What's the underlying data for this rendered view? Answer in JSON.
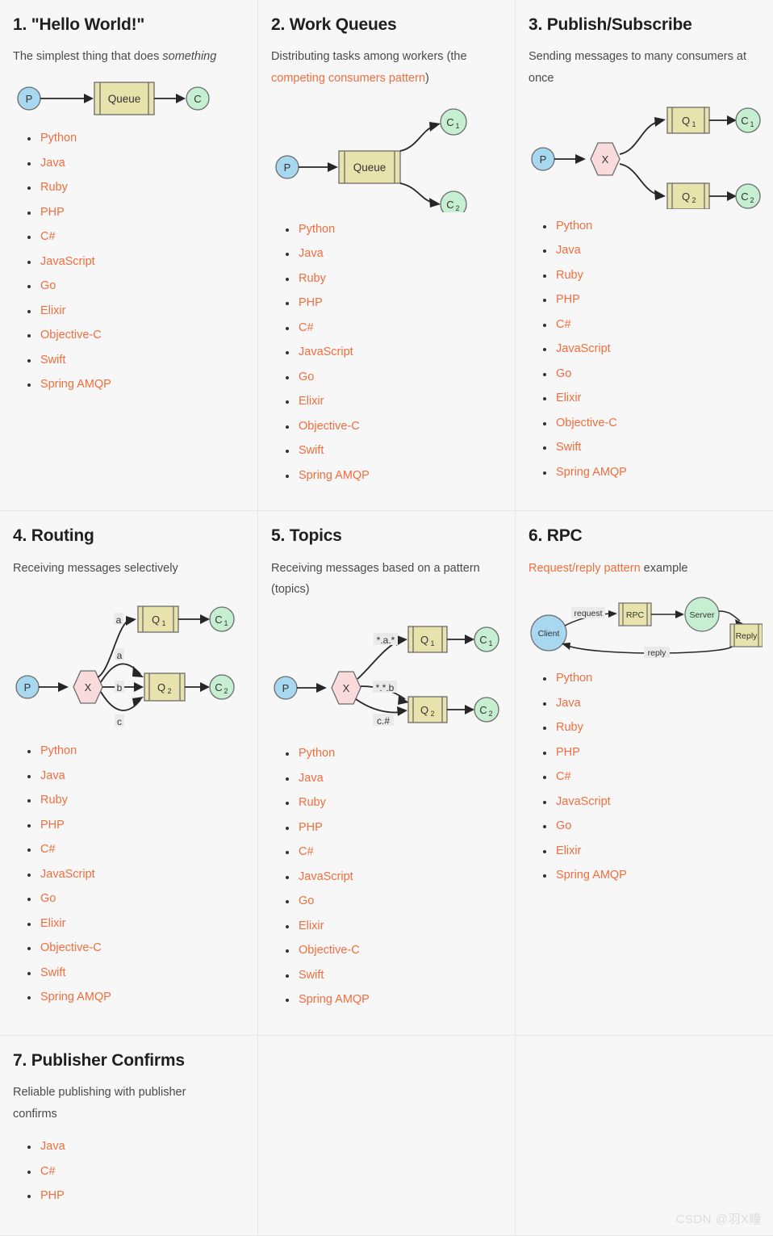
{
  "colors": {
    "link": "#f26d3d",
    "card_bg": "#f7f7f7",
    "queue_fill": "#e8e3ac",
    "producer_fill": "#a8d8f0",
    "consumer_fill": "#c6eed0",
    "exchange_fill": "#fadbdc",
    "stroke": "#6b6b6b",
    "arrow": "#262626",
    "watermark": "#dcdcdc"
  },
  "watermark": "CSDN @羽X瞳",
  "languages_full": [
    "Python",
    "Java",
    "Ruby",
    "PHP",
    "C#",
    "JavaScript",
    "Go",
    "Elixir",
    "Objective-C",
    "Swift",
    "Spring AMQP"
  ],
  "cards": [
    {
      "id": "hello-world",
      "title": "1. \"Hello World!\"",
      "desc_prefix": "The simplest thing that does ",
      "desc_em": "something",
      "desc_suffix": "",
      "diagram": {
        "type": "producer-queue-consumer",
        "nodes": [
          {
            "name": "producer",
            "label": "P"
          },
          {
            "name": "queue",
            "label": "Queue"
          },
          {
            "name": "consumer",
            "label": "C"
          }
        ]
      },
      "languages": [
        "Python",
        "Java",
        "Ruby",
        "PHP",
        "C#",
        "JavaScript",
        "Go",
        "Elixir",
        "Objective-C",
        "Swift",
        "Spring AMQP"
      ]
    },
    {
      "id": "work-queues",
      "title": "2. Work Queues",
      "desc_prefix": "Distributing tasks among workers (the ",
      "desc_link": "competing consumers pattern",
      "desc_suffix": ")",
      "diagram": {
        "type": "producer-queue-two-consumers",
        "nodes": [
          {
            "name": "producer",
            "label": "P"
          },
          {
            "name": "queue",
            "label": "Queue"
          },
          {
            "name": "consumer-1",
            "label": "C",
            "sub": "1"
          },
          {
            "name": "consumer-2",
            "label": "C",
            "sub": "2"
          }
        ]
      },
      "languages": [
        "Python",
        "Java",
        "Ruby",
        "PHP",
        "C#",
        "JavaScript",
        "Go",
        "Elixir",
        "Objective-C",
        "Swift",
        "Spring AMQP"
      ]
    },
    {
      "id": "publish-subscribe",
      "title": "3. Publish/Subscribe",
      "desc_prefix": "Sending messages to many consumers at once",
      "diagram": {
        "type": "fanout",
        "nodes": [
          {
            "name": "producer",
            "label": "P"
          },
          {
            "name": "exchange",
            "label": "X"
          },
          {
            "name": "queue-1",
            "label": "Q",
            "sub": "1"
          },
          {
            "name": "queue-2",
            "label": "Q",
            "sub": "2"
          },
          {
            "name": "consumer-1",
            "label": "C",
            "sub": "1"
          },
          {
            "name": "consumer-2",
            "label": "C",
            "sub": "2"
          }
        ]
      },
      "languages": [
        "Python",
        "Java",
        "Ruby",
        "PHP",
        "C#",
        "JavaScript",
        "Go",
        "Elixir",
        "Objective-C",
        "Swift",
        "Spring AMQP"
      ]
    },
    {
      "id": "routing",
      "title": "4. Routing",
      "desc_prefix": "Receiving messages selectively",
      "diagram": {
        "type": "direct-routing",
        "nodes": [
          {
            "name": "producer",
            "label": "P"
          },
          {
            "name": "exchange",
            "label": "X"
          },
          {
            "name": "queue-1",
            "label": "Q",
            "sub": "1"
          },
          {
            "name": "queue-2",
            "label": "Q",
            "sub": "2"
          },
          {
            "name": "consumer-1",
            "label": "C",
            "sub": "1"
          },
          {
            "name": "consumer-2",
            "label": "C",
            "sub": "2"
          }
        ],
        "binding_keys": [
          "a",
          "a",
          "b",
          "c"
        ]
      },
      "languages": [
        "Python",
        "Java",
        "Ruby",
        "PHP",
        "C#",
        "JavaScript",
        "Go",
        "Elixir",
        "Objective-C",
        "Swift",
        "Spring AMQP"
      ]
    },
    {
      "id": "topics",
      "title": "5. Topics",
      "desc_prefix": "Receiving messages based on a pattern (topics)",
      "diagram": {
        "type": "topic-routing",
        "nodes": [
          {
            "name": "producer",
            "label": "P"
          },
          {
            "name": "exchange",
            "label": "X"
          },
          {
            "name": "queue-1",
            "label": "Q",
            "sub": "1"
          },
          {
            "name": "queue-2",
            "label": "Q",
            "sub": "2"
          },
          {
            "name": "consumer-1",
            "label": "C",
            "sub": "1"
          },
          {
            "name": "consumer-2",
            "label": "C",
            "sub": "2"
          }
        ],
        "binding_keys": [
          "*.a.*",
          "*.*.b",
          "c.#"
        ]
      },
      "languages": [
        "Python",
        "Java",
        "Ruby",
        "PHP",
        "C#",
        "JavaScript",
        "Go",
        "Elixir",
        "Objective-C",
        "Swift",
        "Spring AMQP"
      ]
    },
    {
      "id": "rpc",
      "title": "6. RPC",
      "desc_link": "Request/reply pattern",
      "desc_suffix": " example",
      "diagram": {
        "type": "rpc",
        "nodes": [
          {
            "name": "client",
            "label": "Client"
          },
          {
            "name": "rpc-queue",
            "label": "RPC"
          },
          {
            "name": "server",
            "label": "Server"
          },
          {
            "name": "reply-queue",
            "label": "Reply"
          }
        ],
        "edge_labels": [
          "request",
          "reply"
        ]
      },
      "languages": [
        "Python",
        "Java",
        "Ruby",
        "PHP",
        "C#",
        "JavaScript",
        "Go",
        "Elixir",
        "Spring AMQP"
      ]
    },
    {
      "id": "publisher-confirms",
      "title": "7. Publisher Confirms",
      "desc_prefix": "Reliable publishing with publisher confirms",
      "languages": [
        "Java",
        "C#",
        "PHP"
      ]
    }
  ]
}
